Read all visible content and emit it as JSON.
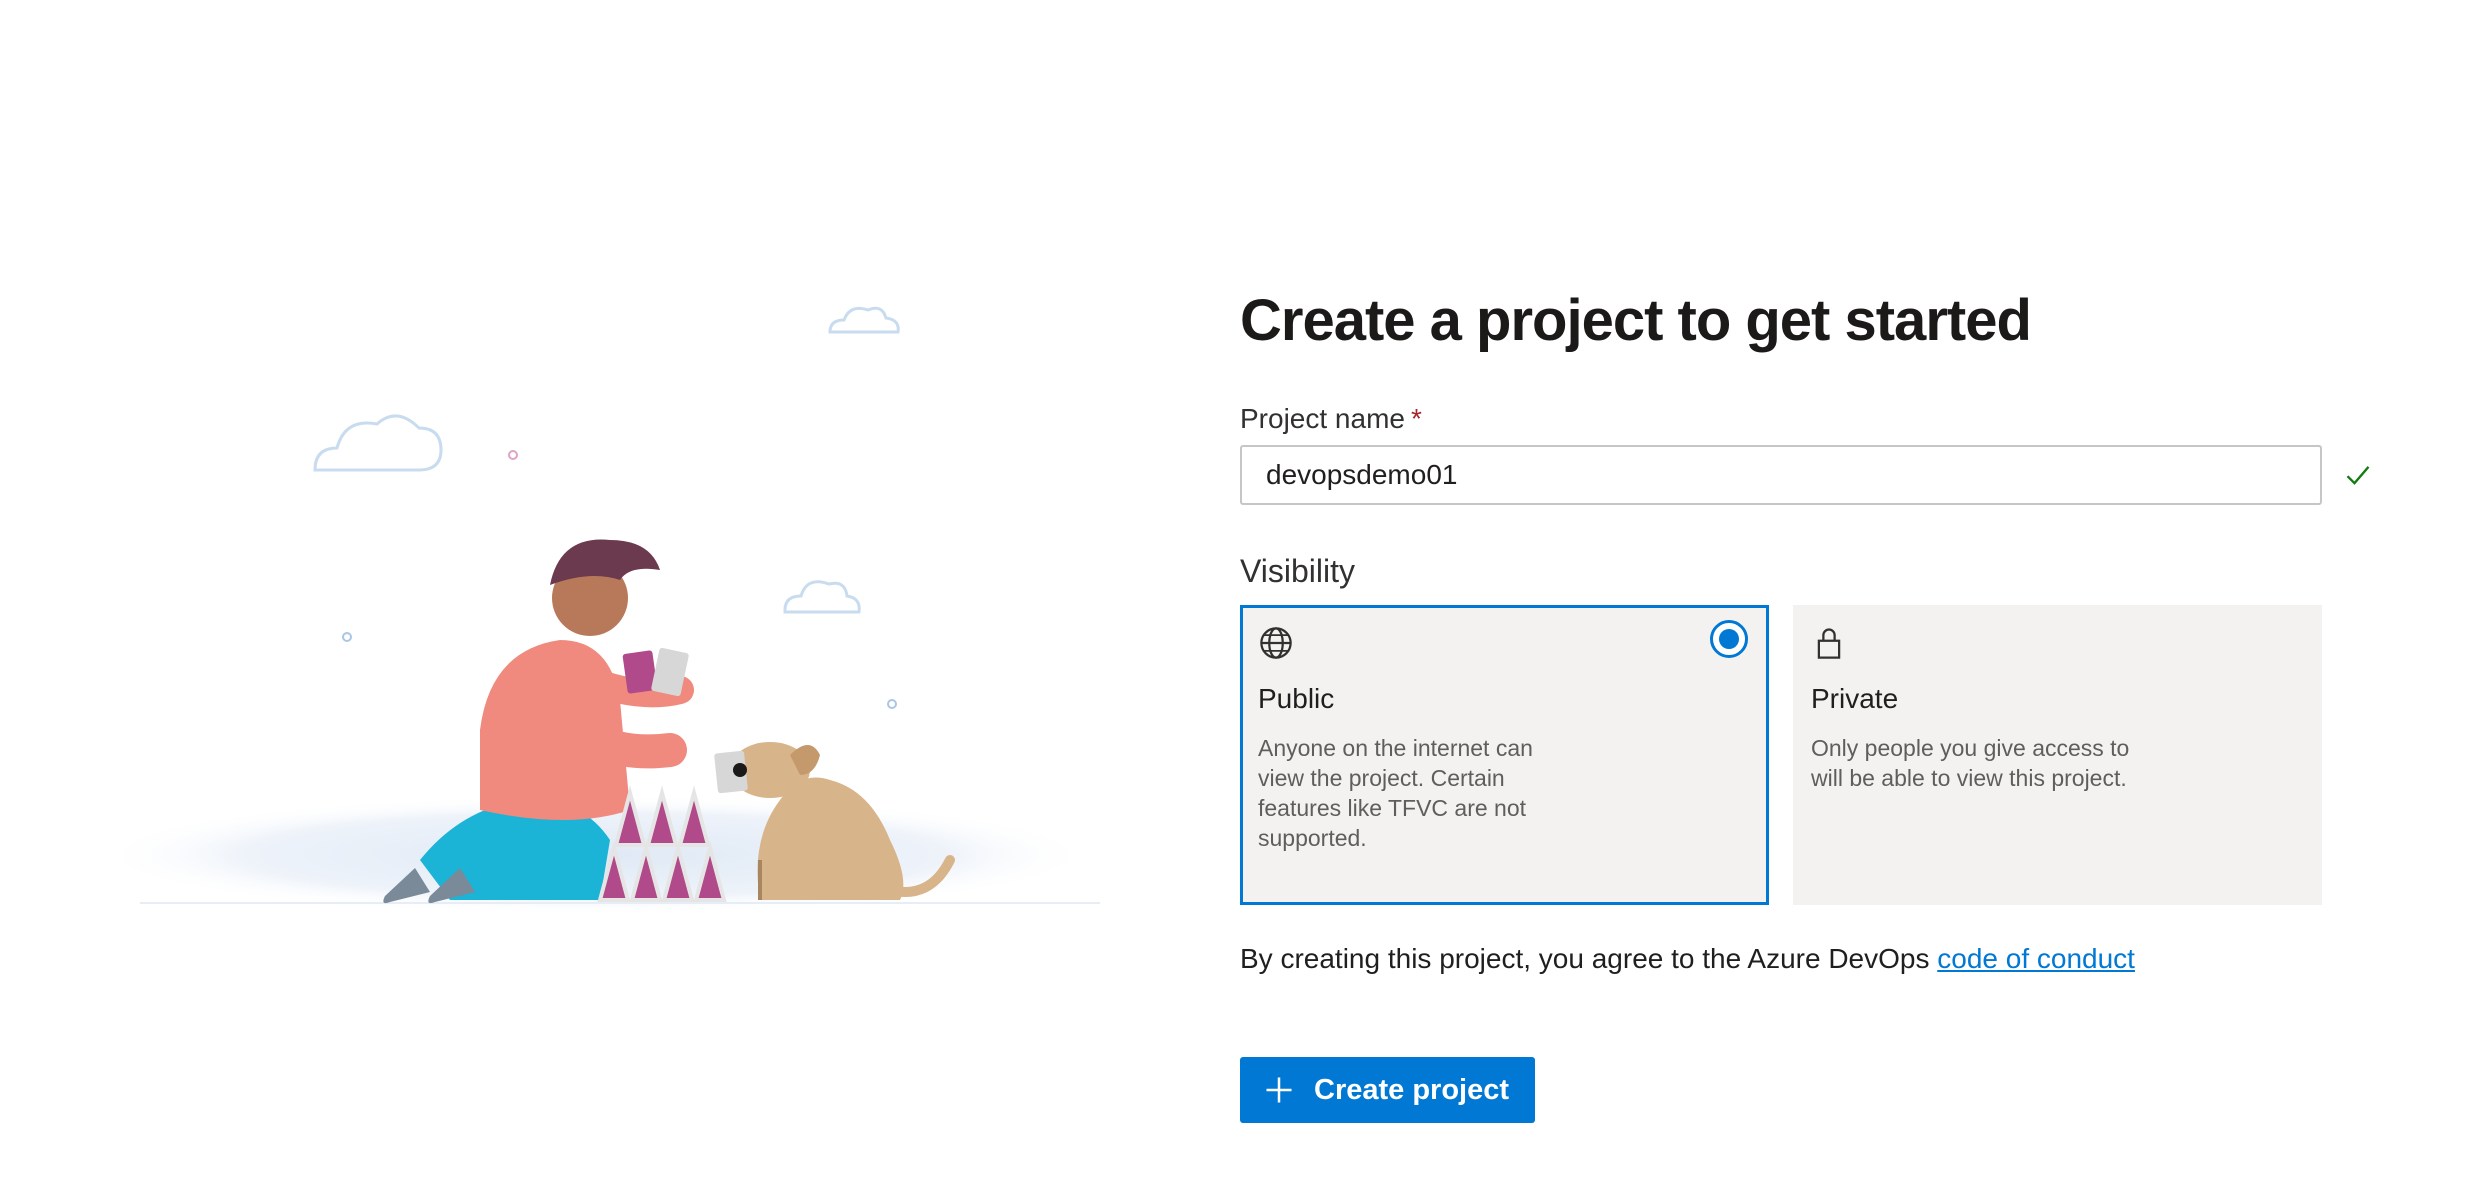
{
  "form": {
    "title": "Create a project to get started",
    "project_name_label": "Project name",
    "required_mark": "*",
    "project_name_value": "devopsdemo01",
    "visibility_label": "Visibility",
    "visibility_options": [
      {
        "title": "Public",
        "description": "Anyone on the internet can view the project. Certain features like TFVC are not supported.",
        "icon": "globe-icon",
        "selected": true
      },
      {
        "title": "Private",
        "description": "Only people you give access to will be able to view this project.",
        "icon": "lock-icon",
        "selected": false
      }
    ],
    "agreement_text": "By creating this project, you agree to the Azure DevOps",
    "agreement_link": "code of conduct",
    "create_button_label": "Create project"
  },
  "colors": {
    "accent": "#0078d4",
    "valid": "#107c10",
    "card_bg": "#f3f2f1"
  }
}
